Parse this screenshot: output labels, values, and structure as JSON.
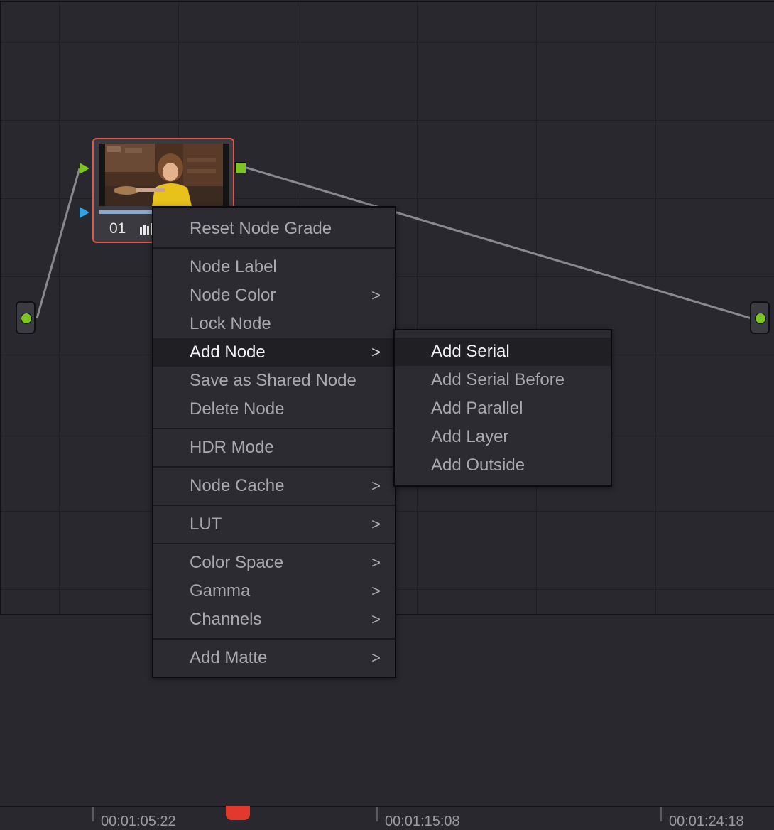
{
  "node": {
    "number": "01",
    "icon": "histogram-icon",
    "progress": 0.42,
    "border_color": "#e2574c"
  },
  "context_menu": {
    "items": [
      {
        "label": "Reset Node Grade"
      },
      {
        "label": "Node Label"
      },
      {
        "label": "Node Color",
        "submenu": true
      },
      {
        "label": "Lock Node"
      },
      {
        "label": "Add Node",
        "submenu": true,
        "active": true
      },
      {
        "label": "Save as Shared Node"
      },
      {
        "label": "Delete Node"
      },
      {
        "label": "HDR Mode"
      },
      {
        "label": "Node Cache",
        "submenu": true
      },
      {
        "label": "LUT",
        "submenu": true
      },
      {
        "label": "Color Space",
        "submenu": true
      },
      {
        "label": "Gamma",
        "submenu": true
      },
      {
        "label": "Channels",
        "submenu": true
      },
      {
        "label": "Add Matte",
        "submenu": true
      }
    ],
    "chevron": ">"
  },
  "add_node_submenu": {
    "items": [
      {
        "label": "Add Serial",
        "active": true
      },
      {
        "label": "Add Serial Before"
      },
      {
        "label": "Add Parallel"
      },
      {
        "label": "Add Layer"
      },
      {
        "label": "Add Outside"
      }
    ]
  },
  "timeline": {
    "timecodes": [
      "00:01:05:22",
      "00:01:15:08",
      "00:01:24:18"
    ]
  },
  "colors": {
    "accent_green": "#7cc41f",
    "accent_blue": "#2fa4e7",
    "playhead_red": "#e2392f",
    "menu_active_bg": "#1f1f24"
  }
}
